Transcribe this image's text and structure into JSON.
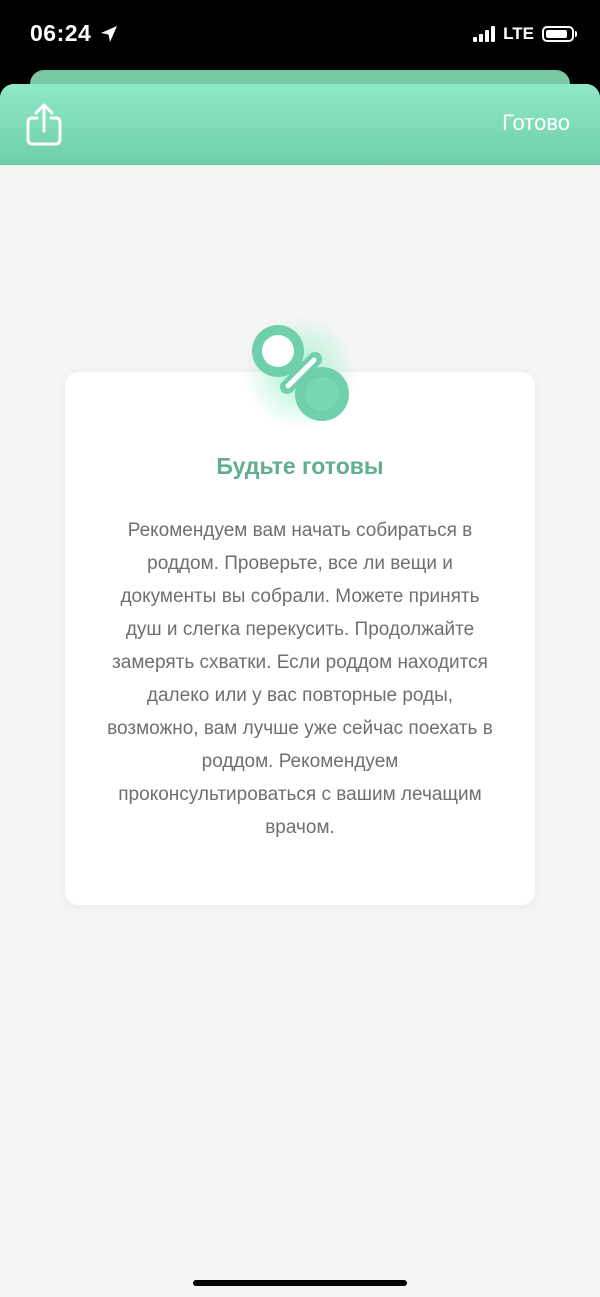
{
  "status_bar": {
    "time": "06:24",
    "network": "LTE"
  },
  "nav": {
    "done_label": "Готово"
  },
  "card": {
    "title": "Будьте готовы",
    "text": "Рекомендуем вам начать собираться в роддом. Проверьте, все ли вещи и документы вы собрали. Можете принять душ и слегка перекусить. Продолжайте замерять схватки. Если роддом находится далеко или у вас повторные роды, возможно, вам лучше уже сейчас поехать в роддом. Рекомендуем проконсультироваться с вашим лечащим врачом."
  },
  "icons": {
    "share": "share-icon",
    "card_badge": "pacifier-icon",
    "location": "location-arrow-icon"
  },
  "colors": {
    "accent": "#79c9a6",
    "title": "#5fae8d",
    "body_text": "#6f6f6f",
    "background": "#f5f5f5"
  }
}
